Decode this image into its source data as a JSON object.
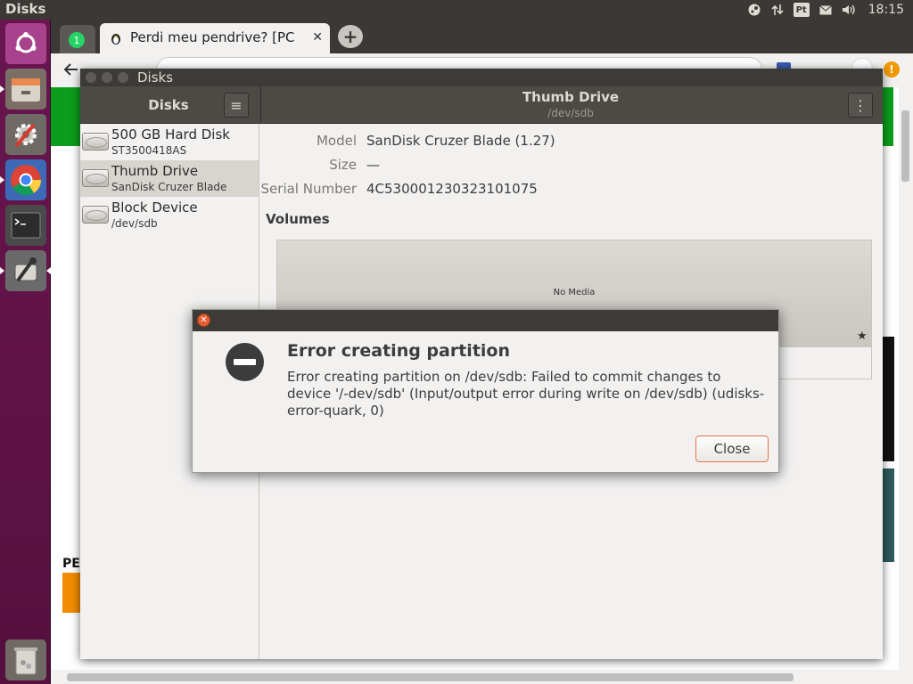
{
  "top_panel": {
    "app_title": "Disks",
    "clock": "18:15",
    "indicators": [
      "steam-icon",
      "transfer-icon",
      "keyboard-layout",
      "mail-icon",
      "volume-icon"
    ],
    "keyboard_layout": "Pt"
  },
  "launcher": {
    "items": [
      "ubuntu-dash-icon",
      "files-icon",
      "system-settings-icon",
      "chrome-icon",
      "terminal-icon",
      "disks-icon",
      "trash-icon"
    ]
  },
  "browser": {
    "inactive_tab_badge": "1",
    "active_tab_title": "Perdi meu pendrive? [PC C",
    "tab_close": "✕",
    "new_tab": "+",
    "page_fragment": "PE",
    "orange_badge": "!"
  },
  "disks": {
    "window_title": "Disks",
    "sidebar_title": "Disks",
    "menu_glyph": "≡",
    "drive_title": "Thumb Drive",
    "drive_path": "/dev/sdb",
    "more_glyph": "⋮",
    "drives": [
      {
        "name": "500 GB Hard Disk",
        "sub": "ST3500418AS"
      },
      {
        "name": "Thumb Drive",
        "sub": "SanDisk Cruzer Blade"
      },
      {
        "name": "Block Device",
        "sub": "/dev/sdb"
      }
    ],
    "properties": [
      {
        "label": "Model",
        "value": "SanDisk Cruzer Blade (1.27)"
      },
      {
        "label": "Size",
        "value": "—"
      },
      {
        "label": "Serial Number",
        "value": "4C530001230323101075"
      }
    ],
    "volumes_title": "Volumes",
    "no_media": "No Media",
    "star_glyph": "★"
  },
  "dialog": {
    "title": "Error creating partition",
    "message": "Error creating partition on /dev/sdb: Failed to commit changes to device '/-dev/sdb' (Input/output error during write on /dev/sdb) (udisks-error-quark, 0)",
    "close_label": "Close",
    "close_x": "✕"
  },
  "colors": {
    "panel": "#3a3935",
    "launcher": "#5e1248",
    "accent_orange": "#e1754b",
    "header": "#4b4a45"
  }
}
